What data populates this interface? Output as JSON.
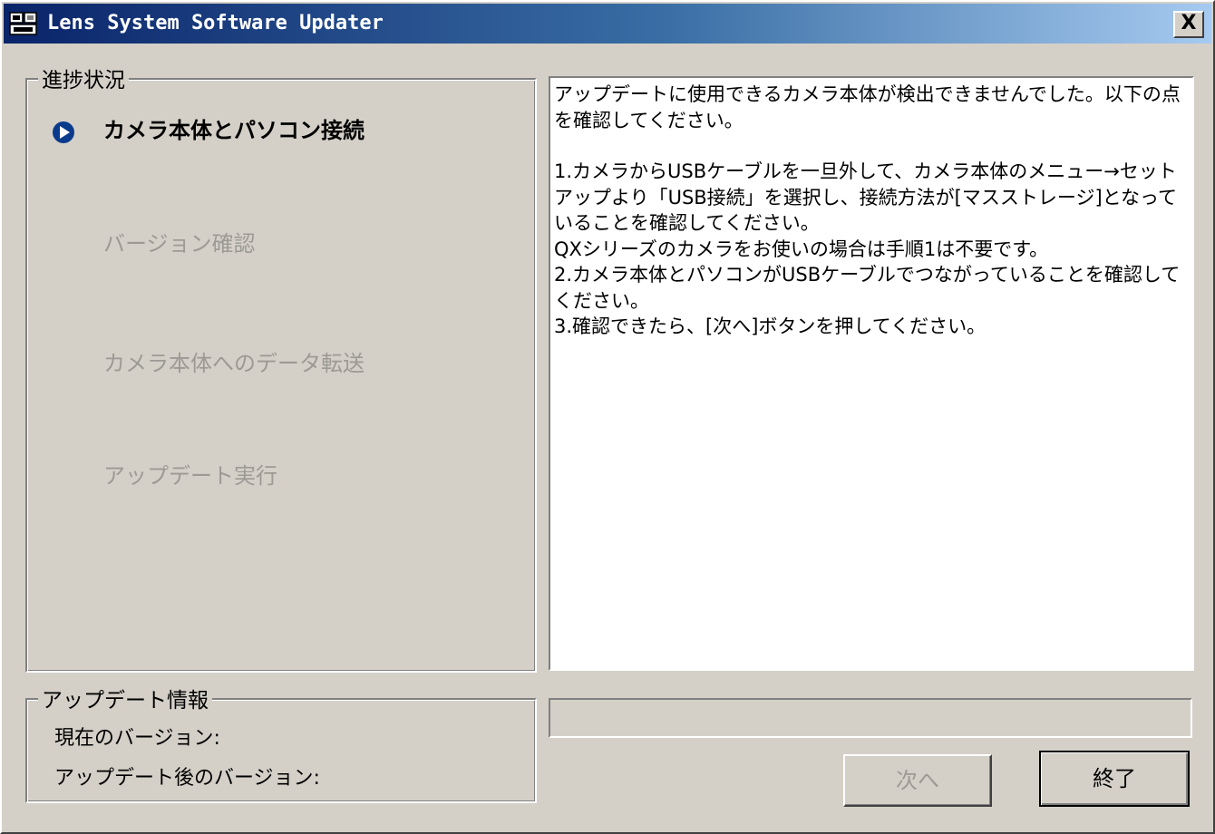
{
  "window": {
    "title": "Lens System Software Updater",
    "close_label": "X"
  },
  "progress_group": {
    "legend": "進捗状況",
    "steps": [
      {
        "label": "カメラ本体とパソコン接続",
        "state": "active"
      },
      {
        "label": "バージョン確認",
        "state": "pending"
      },
      {
        "label": "カメラ本体へのデータ転送",
        "state": "pending"
      },
      {
        "label": "アップデート実行",
        "state": "pending"
      }
    ]
  },
  "message": {
    "paragraph1": "アップデートに使用できるカメラ本体が検出できませんでした。以下の点を確認してください。",
    "step1": "1.カメラからUSBケーブルを一旦外して、カメラ本体のメニュー→セットアップより「USB接続」を選択し、接続方法が[マスストレージ]となっていることを確認してください。",
    "step1_note": "QXシリーズのカメラをお使いの場合は手順1は不要です。",
    "step2": "2.カメラ本体とパソコンがUSBケーブルでつながっていることを確認してください。",
    "step3": "3.確認できたら、[次へ]ボタンを押してください。"
  },
  "update_info": {
    "legend": "アップデート情報",
    "current_version_label": "現在のバージョン:",
    "updated_version_label": "アップデート後のバージョン:"
  },
  "progress_bar": {
    "value": 0
  },
  "buttons": {
    "next_label": "次へ",
    "exit_label": "終了"
  },
  "colors": {
    "title_gradient_start": "#0a246a",
    "title_gradient_end": "#a6caf0",
    "active_step_marker": "#0a3a8c",
    "disabled_text": "#9c9a94"
  }
}
